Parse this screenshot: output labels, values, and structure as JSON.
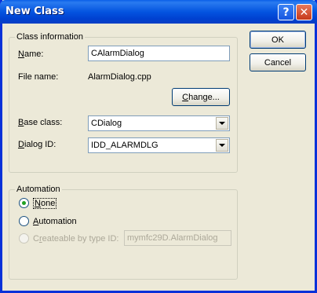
{
  "window": {
    "title": "New Class",
    "help_label": "?",
    "close_label": "✕"
  },
  "class_info": {
    "group_label": "Class information",
    "name_label_prefix": "",
    "name_label_hot": "N",
    "name_label_rest": "ame:",
    "name_value": "CAlarmDialog",
    "file_label": "File name:",
    "file_value": "AlarmDialog.cpp",
    "change_hot": "C",
    "change_rest": "hange...",
    "base_label_hot": "B",
    "base_label_rest": "ase class:",
    "base_value": "CDialog",
    "dialog_label_hot": "D",
    "dialog_label_rest": "ialog ID:",
    "dialog_value": "IDD_ALARMDLG"
  },
  "buttons": {
    "ok": "OK",
    "cancel": "Cancel"
  },
  "automation": {
    "group_label": "Automation",
    "none_hot": "N",
    "none_rest": "one",
    "none_checked": true,
    "auto_hot": "A",
    "auto_rest": "utomation",
    "createable_hot": "r",
    "createable_pre": "C",
    "createable_rest": "eateable by type ID:",
    "type_id_value": "mymfc29D.AlarmDialog"
  }
}
